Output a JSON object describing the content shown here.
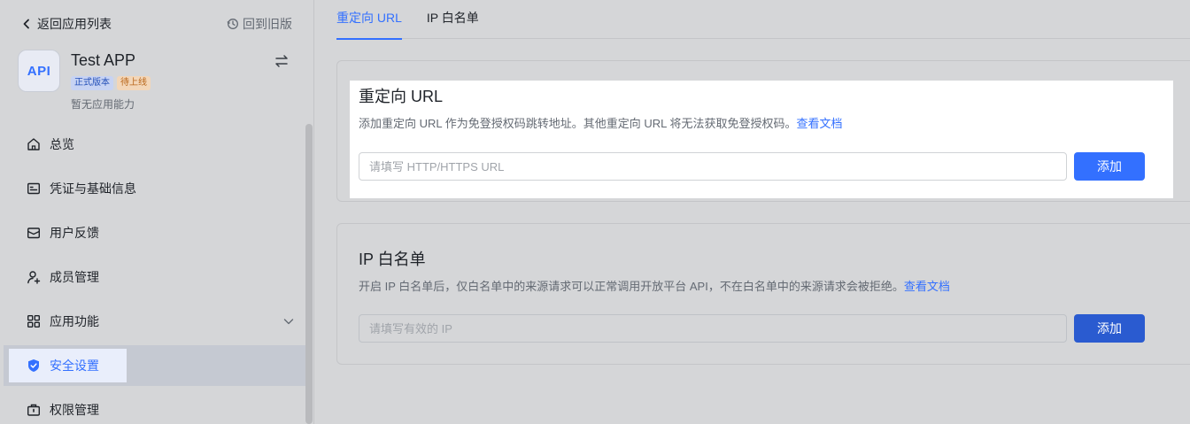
{
  "sidebar": {
    "back_label": "返回应用列表",
    "old_version_label": "回到旧版",
    "app": {
      "logo_text": "API",
      "name": "Test APP",
      "badge_release": "正式版本",
      "badge_pending": "待上线",
      "description": "暂无应用能力"
    },
    "items": [
      {
        "label": "总览",
        "icon": "home-icon"
      },
      {
        "label": "凭证与基础信息",
        "icon": "id-card-icon"
      },
      {
        "label": "用户反馈",
        "icon": "mail-icon"
      },
      {
        "label": "成员管理",
        "icon": "user-add-icon"
      },
      {
        "label": "应用功能",
        "icon": "apps-grid-icon"
      },
      {
        "label": "安全设置",
        "icon": "shield-check-icon",
        "active": true
      },
      {
        "label": "权限管理",
        "icon": "briefcase-icon"
      }
    ]
  },
  "main": {
    "tabs": [
      {
        "label": "重定向 URL",
        "active": true
      },
      {
        "label": "IP 白名单",
        "active": false
      }
    ],
    "redirect": {
      "title": "重定向 URL",
      "description": "添加重定向 URL 作为免登授权码跳转地址。其他重定向 URL 将无法获取免登授权码。",
      "doc_link": "查看文档",
      "input_placeholder": "请填写 HTTP/HTTPS URL",
      "add_label": "添加"
    },
    "ip_whitelist": {
      "title": "IP 白名单",
      "description": "开启 IP 白名单后，仅白名单中的来源请求可以正常调用开放平台 API，不在白名单中的来源请求会被拒绝。",
      "doc_link": "查看文档",
      "input_placeholder": "请填写有效的 IP",
      "add_label": "添加"
    }
  },
  "colors": {
    "accent": "#3370ff",
    "background": "#d5d6d8",
    "text": "#1f2329",
    "muted": "#646a73"
  }
}
